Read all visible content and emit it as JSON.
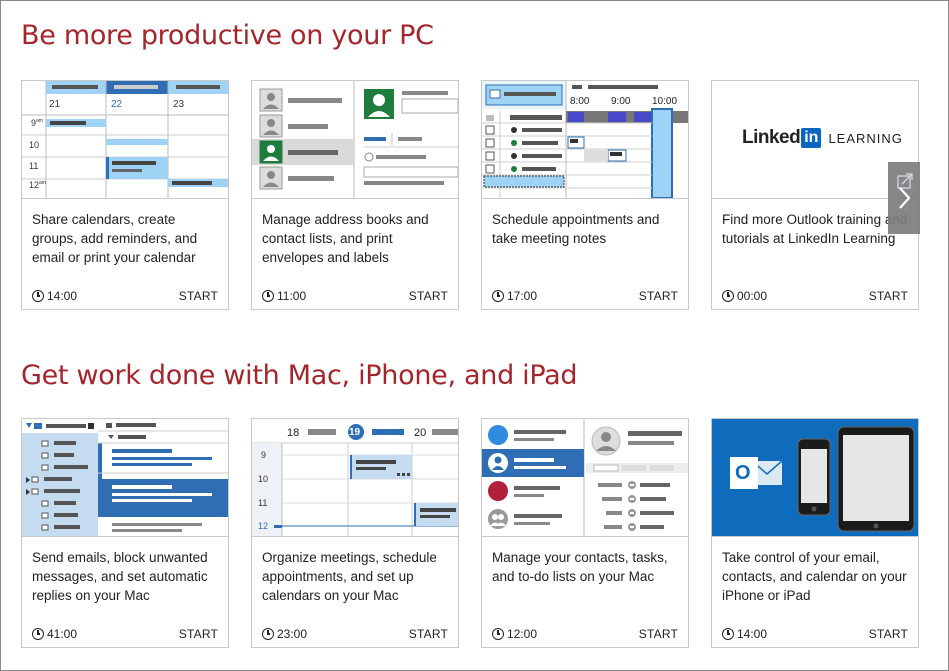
{
  "sections": [
    {
      "title": "Be more productive on your PC",
      "cards": [
        {
          "description": "Share calendars, create groups, add reminders, and email or print your calendar",
          "duration": "14:00",
          "start": "START"
        },
        {
          "description": "Manage address books and contact lists, and print envelopes and labels",
          "duration": "11:00",
          "start": "START"
        },
        {
          "description": "Schedule appointments and take meeting notes",
          "duration": "17:00",
          "start": "START"
        },
        {
          "description": "Find more Outlook training and tutorials at LinkedIn Learning",
          "duration": "00:00",
          "start": "START"
        }
      ]
    },
    {
      "title": "Get work done with Mac, iPhone, and iPad",
      "cards": [
        {
          "description": "Send emails, block unwanted messages, and set automatic replies on your Mac",
          "duration": "41:00",
          "start": "START"
        },
        {
          "description": "Organize meetings, schedule appointments, and set up calendars on your Mac",
          "duration": "23:00",
          "start": "START"
        },
        {
          "description": "Manage your contacts, tasks, and to-do lists on your Mac",
          "duration": "12:00",
          "start": "START"
        },
        {
          "description": "Take control of your email, contacts, and calendar on your iPhone or iPad",
          "duration": "14:00",
          "start": "START"
        }
      ]
    }
  ],
  "thumbnails": {
    "calendar_days": [
      "21",
      "22",
      "23"
    ],
    "calendar_hours": [
      "9",
      "10",
      "11",
      "12"
    ],
    "calendar_hour_suffix": "am",
    "schedule_times": [
      "8:00",
      "9:00",
      "10:00"
    ],
    "linkedin_brand": "Linked",
    "linkedin_in": "in",
    "linkedin_learning": "LEARNING",
    "mac_cal_days": [
      "18",
      "19",
      "20"
    ],
    "mac_cal_hours": [
      "9",
      "10",
      "11",
      "12"
    ],
    "outlook_letter": "O"
  },
  "colors": {
    "accent_red": "#a4262c",
    "outlook_blue": "#0f6cbd",
    "light_blue": "#9fd3f5",
    "linkedin_blue": "#0a66c2"
  },
  "icons": {
    "clock": "clock-icon",
    "next": "chevron-right-icon",
    "popout": "popout-icon"
  }
}
